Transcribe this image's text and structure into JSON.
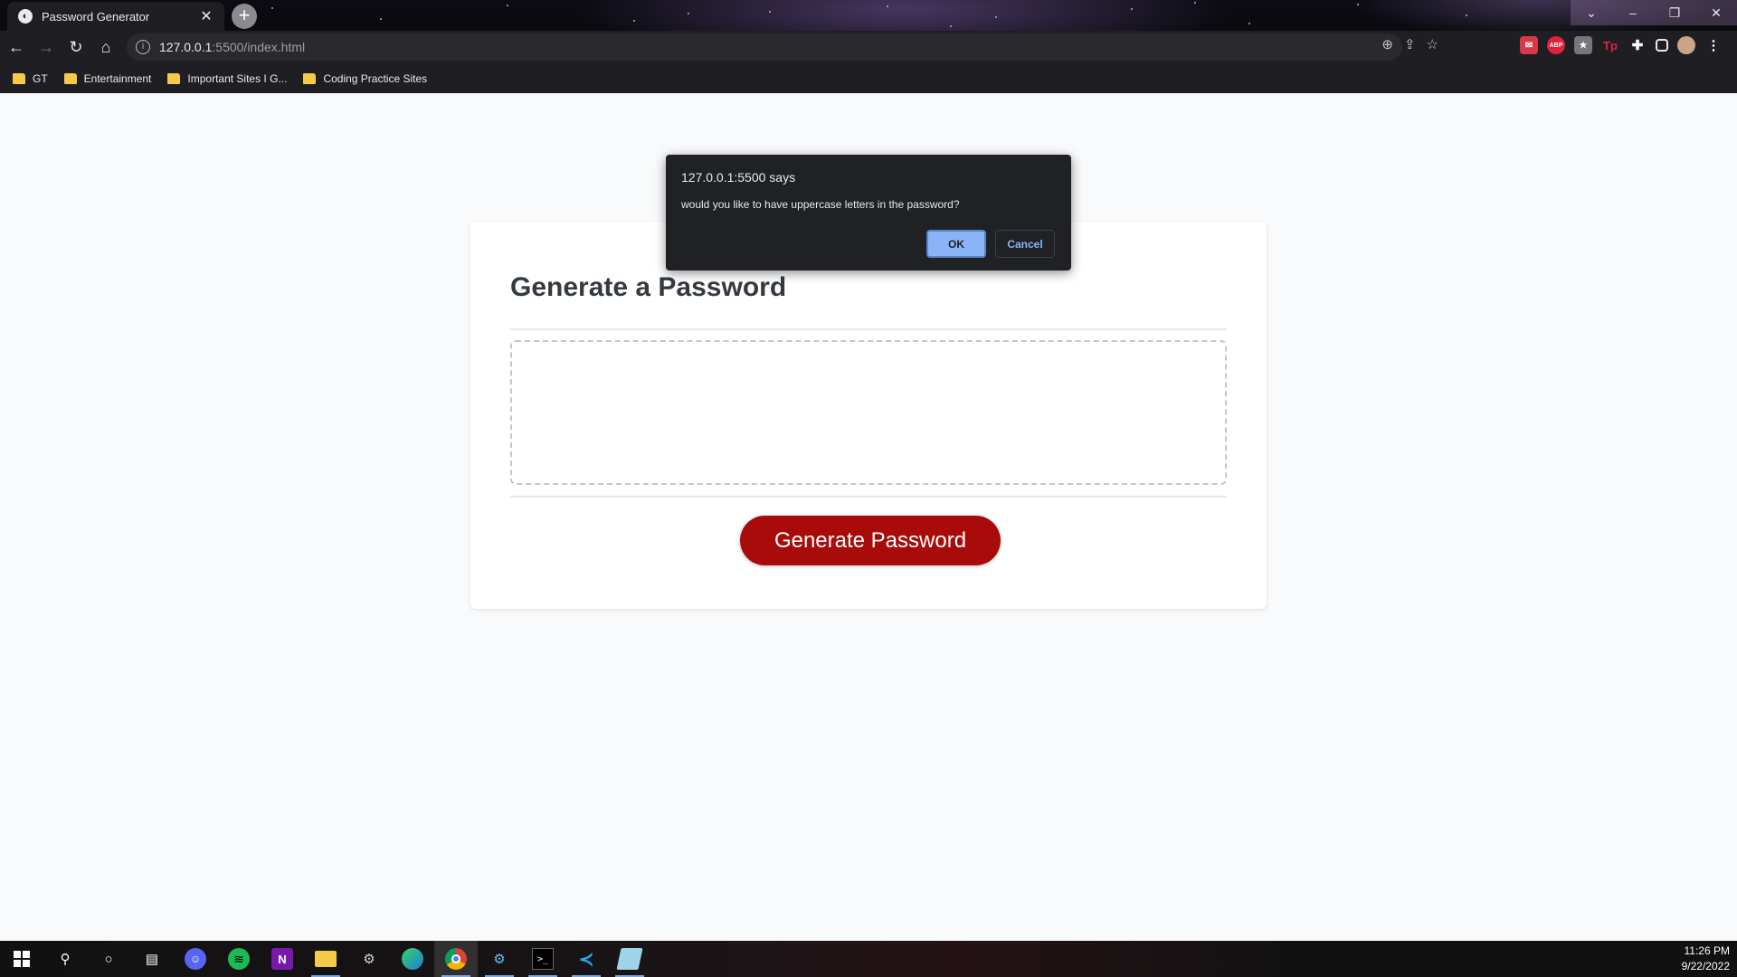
{
  "browser": {
    "tab_title": "Password Generator",
    "url_host": "127.0.0.1",
    "url_path": ":5500/index.html",
    "bookmarks": [
      "GT",
      "Entertainment",
      "Important Sites I G...",
      "Coding Practice Sites"
    ],
    "extension_labels": [
      "ABP",
      "Tp"
    ]
  },
  "alert": {
    "origin": "127.0.0.1:5500 says",
    "message": "would you like to have uppercase letters in the password?",
    "ok_label": "OK",
    "cancel_label": "Cancel"
  },
  "page": {
    "title": "Generate a Password",
    "password_value": "",
    "generate_label": "Generate Password"
  },
  "taskbar": {
    "time": "11:26 PM",
    "date": "9/22/2022",
    "apps": [
      "start",
      "search",
      "cortana",
      "task-view",
      "discord",
      "spotify",
      "onenote",
      "file-explorer",
      "steam",
      "edge",
      "chrome",
      "steam-2",
      "terminal",
      "vscode",
      "notepad"
    ]
  },
  "colors": {
    "primary_button": "#a90b0b",
    "dialog_ok": "#8ab4f8",
    "card_title": "#343a40"
  }
}
